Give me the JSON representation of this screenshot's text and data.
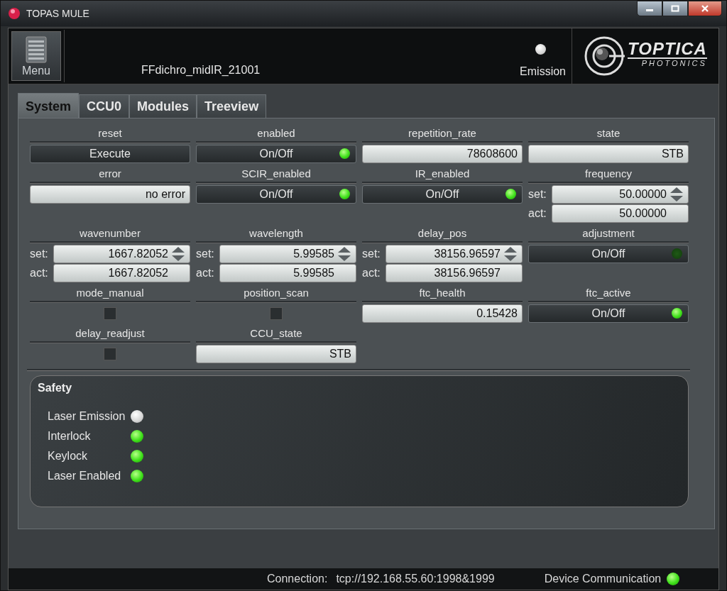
{
  "window": {
    "title": "TOPAS MULE"
  },
  "toolbar": {
    "menu_label": "Menu",
    "device_name": "FFdichro_midIR_21001",
    "emission": {
      "label": "Emission",
      "on": false
    },
    "logo": {
      "name": "TOPTICA",
      "subtitle": "PHOTONICS"
    }
  },
  "tabs": [
    {
      "label": "System",
      "selected": true
    },
    {
      "label": "CCU0",
      "selected": false
    },
    {
      "label": "Modules",
      "selected": false
    },
    {
      "label": "Treeview",
      "selected": false
    }
  ],
  "parameters": [
    {
      "label": "reset",
      "kind": "button",
      "text": "Execute"
    },
    {
      "label": "enabled",
      "kind": "toggle",
      "text": "On/Off",
      "on": true
    },
    {
      "label": "repetition_rate",
      "kind": "readout",
      "value": "78608600"
    },
    {
      "label": "state",
      "kind": "readout",
      "value": "STB"
    },
    {
      "label": "error",
      "kind": "readout",
      "value": "no error"
    },
    {
      "label": "SCIR_enabled",
      "kind": "toggle",
      "text": "On/Off",
      "on": true
    },
    {
      "label": "IR_enabled",
      "kind": "toggle",
      "text": "On/Off",
      "on": true
    },
    {
      "label": "frequency",
      "kind": "setact",
      "set_label": "set:",
      "set": "50.00000",
      "act_label": "act:",
      "act": "50.00000"
    },
    {
      "label": "wavenumber",
      "kind": "setact",
      "set_label": "set:",
      "set": "1667.82052",
      "act_label": "act:",
      "act": "1667.82052"
    },
    {
      "label": "wavelength",
      "kind": "setact",
      "set_label": "set:",
      "set": "5.99585",
      "act_label": "act:",
      "act": "5.99585"
    },
    {
      "label": "delay_pos",
      "kind": "setact",
      "set_label": "set:",
      "set": "38156.96597",
      "act_label": "act:",
      "act": "38156.96597"
    },
    {
      "label": "adjustment",
      "kind": "toggle",
      "text": "On/Off",
      "on": false
    },
    {
      "label": "mode_manual",
      "kind": "checkbox",
      "checked": false
    },
    {
      "label": "position_scan",
      "kind": "checkbox",
      "checked": false
    },
    {
      "label": "ftc_health",
      "kind": "readout",
      "value": "0.15428"
    },
    {
      "label": "ftc_active",
      "kind": "toggle",
      "text": "On/Off",
      "on": true
    },
    {
      "label": "delay_readjust",
      "kind": "checkbox",
      "checked": false
    },
    {
      "label": "CCU_state",
      "kind": "readout",
      "value": "STB"
    }
  ],
  "safety": {
    "title": "Safety",
    "indicators": [
      {
        "label": "Laser Emission",
        "on": false
      },
      {
        "label": "Interlock",
        "on": true
      },
      {
        "label": "Keylock",
        "on": true
      },
      {
        "label": "Laser Enabled",
        "on": true
      }
    ]
  },
  "status_bar": {
    "connection_label": "Connection:",
    "connection": "tcp://192.168.55.60:1998&1999",
    "device_communication": {
      "label": "Device Communication",
      "on": true
    }
  }
}
